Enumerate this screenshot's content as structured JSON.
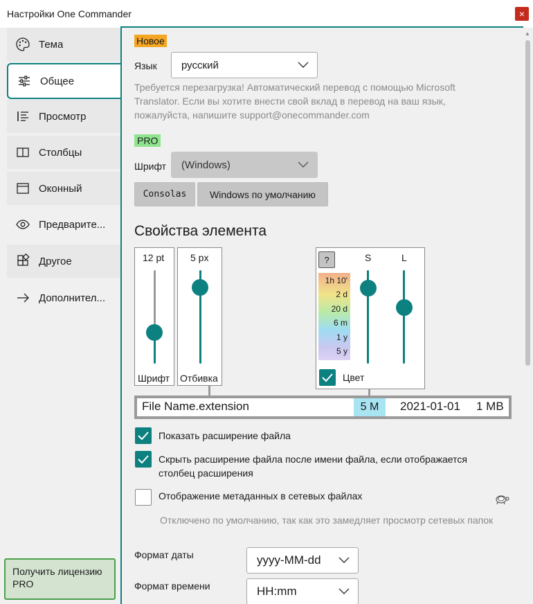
{
  "window": {
    "title": "Настройки One Commander",
    "close_glyph": "×"
  },
  "sidebar": {
    "items": [
      {
        "label": "Тема",
        "icon": "palette-icon"
      },
      {
        "label": "Общее",
        "icon": "sliders-icon",
        "active": true
      },
      {
        "label": "Просмотр",
        "icon": "list-view-icon"
      },
      {
        "label": "Столбцы",
        "icon": "columns-icon"
      },
      {
        "label": "Оконный",
        "icon": "window-icon"
      },
      {
        "label": "Предварите...",
        "icon": "eye-icon"
      },
      {
        "label": "Другое",
        "icon": "blocks-icon"
      },
      {
        "label": "Дополнител...",
        "icon": "arrow-right-icon"
      }
    ],
    "license_button": "Получить лицензию PRO"
  },
  "general": {
    "new_badge": "Новое",
    "language": {
      "label": "Язык",
      "value": "русский",
      "note": "Требуется перезагрузка! Автоматический перевод с помощью Microsoft Translator. Если вы хотите внести свой вклад в перевод на ваш язык, пожалуйста, напишите support@onecommander.com"
    },
    "pro_badge": "PRO",
    "font": {
      "label": "Шрифт",
      "value": "(Windows)",
      "preset_consolas": "Consolas",
      "preset_default": "Windows по умолчанию"
    }
  },
  "element_properties": {
    "heading": "Свойства элемента",
    "font_slider": {
      "value_label": "12 pt",
      "caption": "Шрифт",
      "level": 0.17
    },
    "padding_slider": {
      "value_label": "5 px",
      "caption": "Отбивка",
      "level": 0.83
    },
    "color_panel": {
      "help_button": "?",
      "s_label": "S",
      "l_label": "L",
      "s_level": 0.83,
      "l_level": 0.58,
      "time_labels": [
        "1h 10'",
        "2 d",
        "20 d",
        "6 m",
        "1 y",
        "5 y"
      ],
      "color_checkbox_label": "Цвет",
      "color_checked": true
    },
    "preview": {
      "filename": "File Name.extension",
      "age": "5 M",
      "date": "2021-01-01",
      "size": "1 MB",
      "age_color": "#a8e4f2"
    }
  },
  "options": {
    "show_extension": {
      "label": "Показать расширение файла",
      "checked": true
    },
    "hide_extension": {
      "label": "Скрыть расширение файла после имени файла, если отображается столбец расширения",
      "checked": true
    },
    "network_metadata": {
      "label": "Отображение метаданных в сетевых файлах",
      "checked": false,
      "icon": "turtle-icon"
    },
    "network_note": "Отключено по умолчанию, так как это замедляет просмотр сетевых папок"
  },
  "formats": {
    "date_label": "Формат даты",
    "date_value": "yyyy-MM-dd",
    "time_label": "Формат времени",
    "time_value": "HH:mm"
  },
  "colors": {
    "accent": "#0d8080",
    "new_badge": "#f5a623",
    "pro_badge": "#8fe58f",
    "close": "#c42b1c",
    "license_border": "#4aa04a"
  }
}
